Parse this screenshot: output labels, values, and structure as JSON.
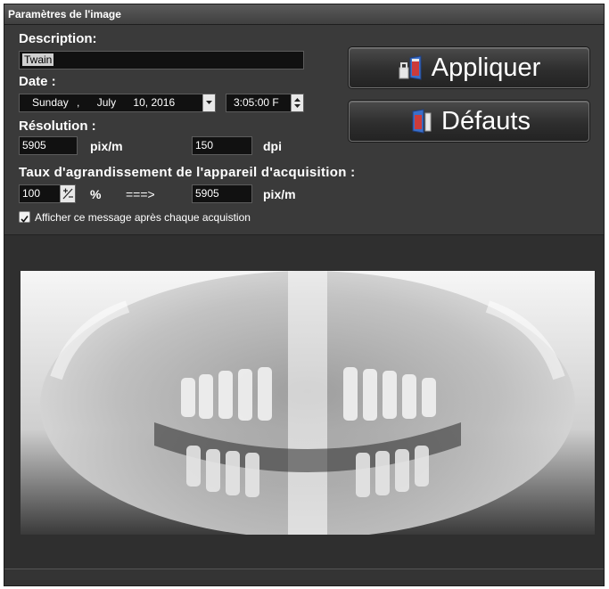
{
  "window": {
    "title": "Paramètres de l'image"
  },
  "description": {
    "label": "Description:",
    "value": "Twain"
  },
  "date": {
    "label": "Date :",
    "day": "Sunday",
    "sep1": ",",
    "month": "July",
    "daynum_year": "10, 2016",
    "time": "3:05:00 F"
  },
  "resolution": {
    "label": "Résolution :",
    "pix_value": "5905",
    "pix_unit": "pix/m",
    "dpi_value": "150",
    "dpi_unit": "dpi"
  },
  "magnification": {
    "label": "Taux d'agrandissement de l'appareil d'acquisition :",
    "percent_value": "100",
    "percent_unit": "%",
    "arrow": "===>",
    "pix_value": "5905",
    "pix_unit": "pix/m"
  },
  "checkbox": {
    "label": "Afficher ce message après chaque acquistion",
    "checked": true
  },
  "buttons": {
    "apply": "Appliquer",
    "defaults": "Défauts"
  },
  "preview": {
    "image": "panoramic-dental-xray"
  }
}
